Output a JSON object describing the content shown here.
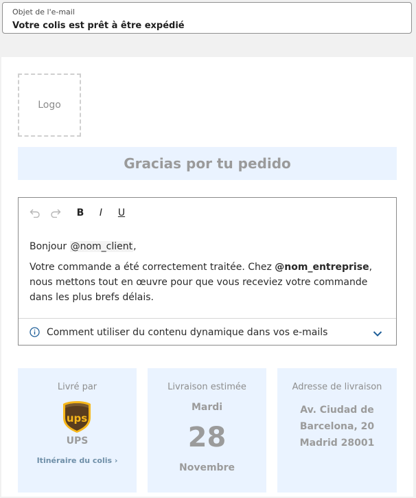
{
  "subject": {
    "label": "Objet de l'e-mail",
    "value": "Votre colis est prêt à être expédié"
  },
  "email": {
    "logo_placeholder": "Logo",
    "banner_title": "Gracias por tu pedido",
    "editor": {
      "toolbar": {
        "undo_icon": "undo-icon",
        "redo_icon": "redo-icon",
        "bold_label": "B",
        "italic_label": "I",
        "underline_label": "U"
      },
      "greeting_prefix": "Bonjour ",
      "greeting_var": "@nom_client",
      "greeting_suffix": ",",
      "paragraph_prefix": "Votre commande a été correctement traitée. Chez ",
      "paragraph_var": "@nom_entreprise",
      "paragraph_suffix": ", nous mettons tout en œuvre pour que vous receviez votre commande dans les plus brefs délais.",
      "help_text": "Comment utiliser du contenu dynamique dans vos e-mails",
      "help_icon": "info-icon",
      "expand_icon": "chevron-down-icon"
    },
    "cards": {
      "carrier": {
        "title": "Livré par",
        "name": "UPS",
        "logo_text": "ups",
        "tracking_link": "Itinéraire du colis ›"
      },
      "delivery": {
        "title": "Livraison estimée",
        "day_name": "Mardi",
        "day_number": "28",
        "month": "Novembre"
      },
      "address": {
        "title": "Adresse de livraison",
        "line1": "Av. Ciudad de",
        "line2": "Barcelona, 20",
        "line3": "Madrid 28001"
      }
    }
  },
  "colors": {
    "accent": "#1f5f99",
    "card_bg": "#eaf3ff",
    "ups_brown": "#5a3d1e",
    "ups_gold": "#f7b71a"
  }
}
